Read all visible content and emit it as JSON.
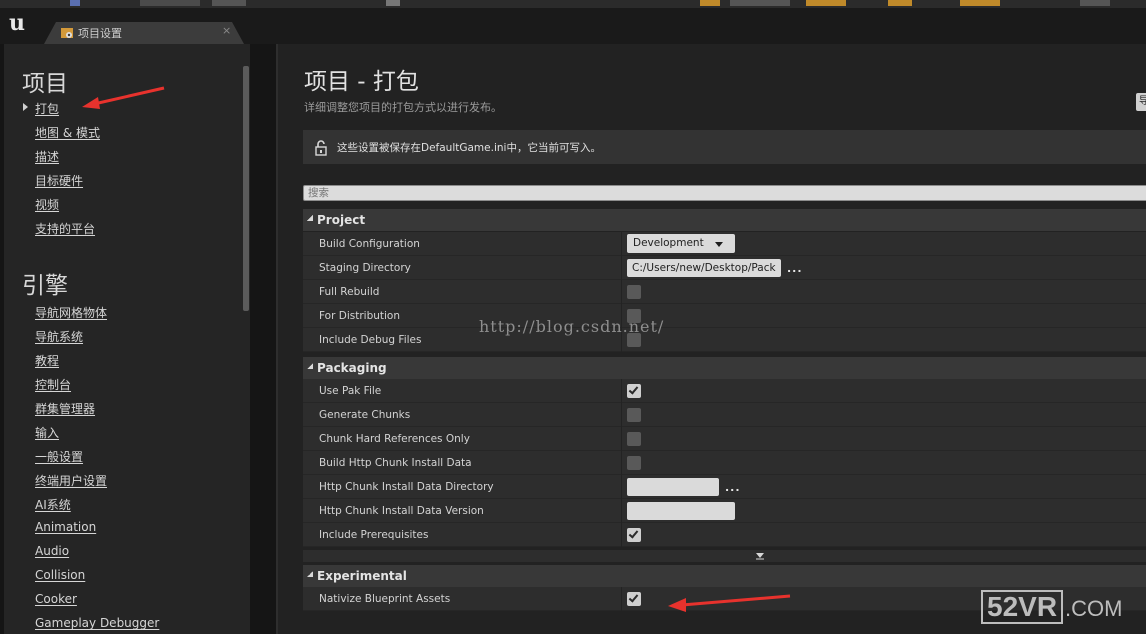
{
  "tab": {
    "title": "项目设置",
    "close": "×"
  },
  "sidebar": {
    "project_heading": "项目",
    "project_items": [
      "打包",
      "地图 & 模式",
      "描述",
      "目标硬件",
      "视频",
      "支持的平台"
    ],
    "engine_heading": "引擎",
    "engine_items": [
      "导航网格物体",
      "导航系统",
      "教程",
      "控制台",
      "群集管理器",
      "输入",
      "一般设置",
      "终端用户设置",
      "AI系统",
      "Animation",
      "Audio",
      "Collision",
      "Cooker",
      "Gameplay Debugger"
    ]
  },
  "main": {
    "title": "项目 - 打包",
    "subtitle": "详细调整您项目的打包方式以进行发布。",
    "notice": "这些设置被保存在DefaultGame.ini中，它当前可写入。",
    "search_placeholder": "搜索",
    "categories": {
      "project": {
        "label": "Project",
        "rows": [
          {
            "label": "Build Configuration",
            "value": "Development"
          },
          {
            "label": "Staging Directory",
            "value": "C:/Users/new/Desktop/Pack",
            "dots": "..."
          },
          {
            "label": "Full Rebuild",
            "checked": false
          },
          {
            "label": "For Distribution",
            "checked": false
          },
          {
            "label": "Include Debug Files",
            "checked": false
          }
        ]
      },
      "packaging": {
        "label": "Packaging",
        "rows": [
          {
            "label": "Use Pak File",
            "checked": true
          },
          {
            "label": "Generate Chunks",
            "checked": false
          },
          {
            "label": "Chunk Hard References Only",
            "checked": false
          },
          {
            "label": "Build Http Chunk Install Data",
            "checked": false
          },
          {
            "label": "Http Chunk Install Data Directory",
            "value": "",
            "dots": "..."
          },
          {
            "label": "Http Chunk Install Data Version",
            "value": ""
          },
          {
            "label": "Include Prerequisites",
            "checked": true
          }
        ]
      },
      "experimental": {
        "label": "Experimental",
        "rows": [
          {
            "label": "Nativize Blueprint Assets",
            "checked": true
          }
        ]
      }
    }
  },
  "overlay": {
    "watermark": "http://blog.csdn.net/",
    "brand_box": "52VR",
    "brand_suffix": ".COM"
  },
  "colors": {
    "annotation_arrow": "#e8322d",
    "panel_bg": "#222222",
    "row_bg": "#2d2d2d"
  }
}
